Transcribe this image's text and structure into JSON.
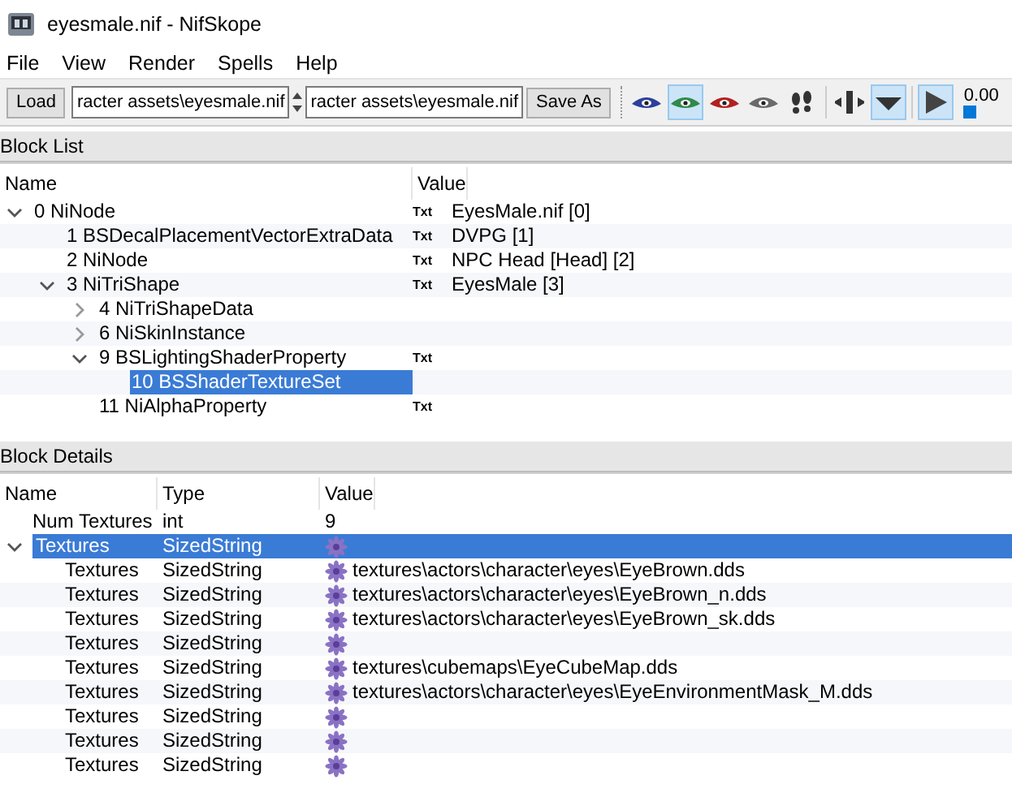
{
  "window": {
    "title": "eyesmale.nif - NifSkope"
  },
  "menu": [
    "File",
    "View",
    "Render",
    "Spells",
    "Help"
  ],
  "toolbar": {
    "load_button": "Load",
    "fields": [
      {
        "value": "racter assets\\eyesmale.nif"
      },
      {
        "value": "racter assets\\eyesmale.nif"
      }
    ],
    "save_button": "Save As",
    "tools": [
      {
        "kind": "eye",
        "color": "#2c3f9a",
        "on": false
      },
      {
        "kind": "eye",
        "color": "#2f8a4a",
        "on": true
      },
      {
        "kind": "eye",
        "color": "#b32020",
        "on": false
      },
      {
        "kind": "eye",
        "color": "#6a6a6a",
        "on": false
      },
      {
        "kind": "footprints",
        "on": false
      },
      {
        "kind": "separator"
      },
      {
        "kind": "split",
        "on": false
      },
      {
        "kind": "dropdown",
        "on": true
      },
      {
        "kind": "separator"
      },
      {
        "kind": "play",
        "on": true
      }
    ],
    "time": "0.00"
  },
  "block_list": {
    "title": "Block List",
    "columns": [
      "Name",
      "Value"
    ],
    "rows": [
      {
        "name": "0 NiNode",
        "tag": "Txt",
        "value": "EyesMale.nif [0]",
        "selected": false,
        "expanded": true,
        "children": [
          {
            "name": "1 BSDecalPlacementVectorExtraData",
            "tag": "Txt",
            "value": "DVPG [1]",
            "selected": false
          },
          {
            "name": "2 NiNode",
            "tag": "Txt",
            "value": "NPC Head [Head] [2]",
            "selected": false
          },
          {
            "name": "3 NiTriShape",
            "tag": "Txt",
            "value": "EyesMale [3]",
            "selected": false,
            "expanded": true,
            "children": [
              {
                "name": "4 NiTriShapeData",
                "selected": false,
                "expanded": false
              },
              {
                "name": "6 NiSkinInstance",
                "selected": false,
                "expanded": false
              },
              {
                "name": "9 BSLightingShaderProperty",
                "tag": "Txt",
                "selected": false,
                "expanded": true,
                "children": [
                  {
                    "name": "10 BSShaderTextureSet",
                    "selected": true
                  }
                ]
              },
              {
                "name": "11 NiAlphaProperty",
                "tag": "Txt",
                "selected": false
              }
            ]
          }
        ]
      }
    ]
  },
  "block_details": {
    "title": "Block Details",
    "columns": [
      "Name",
      "Type",
      "Value"
    ],
    "rows": [
      {
        "name": "Num Textures",
        "type": "int",
        "kind": "plain",
        "value": "9",
        "selected": false
      },
      {
        "name": "Textures",
        "type": "SizedString",
        "kind": "string",
        "selected": true,
        "expanded": true,
        "children": [
          {
            "name": "Textures",
            "type": "SizedString",
            "kind": "string",
            "value": "textures\\actors\\character\\eyes\\EyeBrown.dds",
            "selected": false
          },
          {
            "name": "Textures",
            "type": "SizedString",
            "kind": "string",
            "value": "textures\\actors\\character\\eyes\\EyeBrown_n.dds",
            "selected": false
          },
          {
            "name": "Textures",
            "type": "SizedString",
            "kind": "string",
            "value": "textures\\actors\\character\\eyes\\EyeBrown_sk.dds",
            "selected": false
          },
          {
            "name": "Textures",
            "type": "SizedString",
            "kind": "string",
            "selected": false
          },
          {
            "name": "Textures",
            "type": "SizedString",
            "kind": "string",
            "value": "textures\\cubemaps\\EyeCubeMap.dds",
            "selected": false
          },
          {
            "name": "Textures",
            "type": "SizedString",
            "kind": "string",
            "value": "textures\\actors\\character\\eyes\\EyeEnvironmentMask_M.dds",
            "selected": false
          },
          {
            "name": "Textures",
            "type": "SizedString",
            "kind": "string",
            "selected": false
          },
          {
            "name": "Textures",
            "type": "SizedString",
            "kind": "string",
            "selected": false
          },
          {
            "name": "Textures",
            "type": "SizedString",
            "kind": "string",
            "selected": false
          }
        ]
      }
    ]
  }
}
